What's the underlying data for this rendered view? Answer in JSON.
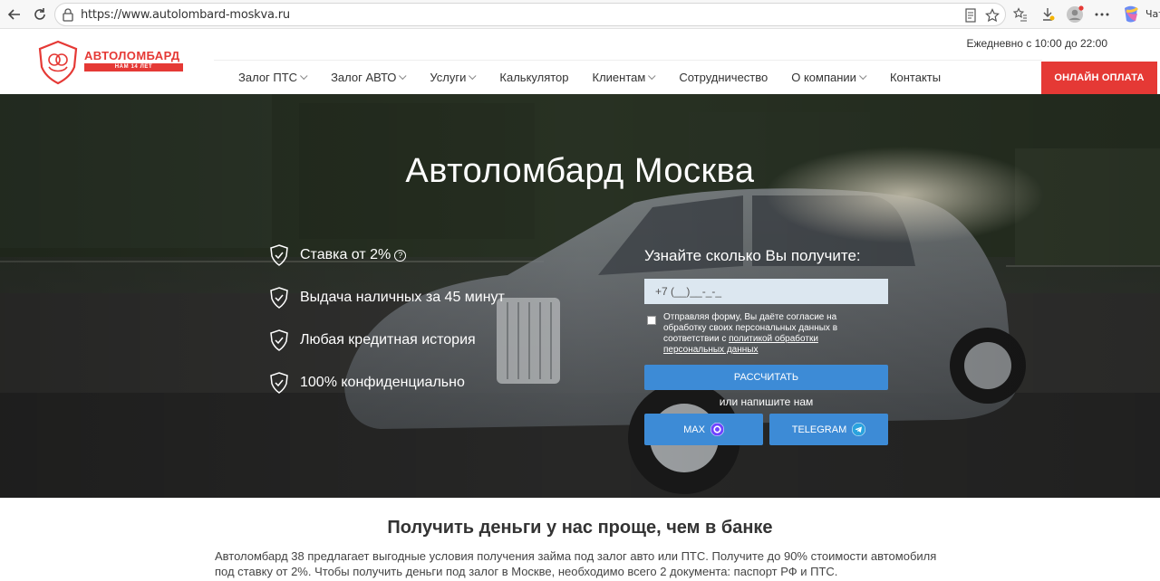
{
  "browser": {
    "url": "https://www.autolombard-moskva.ru",
    "chat_label": "Чат"
  },
  "header": {
    "brand": "АВТОЛОМБАРД",
    "brand_tagline": "НАМ 14 ЛЕТ",
    "schedule": "Ежедневно с 10:00 до 22:00",
    "nav": [
      {
        "label": "Залог ПТС",
        "dropdown": true
      },
      {
        "label": "Залог АВТО",
        "dropdown": true
      },
      {
        "label": "Услуги",
        "dropdown": true
      },
      {
        "label": "Калькулятор",
        "dropdown": false
      },
      {
        "label": "Клиентам",
        "dropdown": true
      },
      {
        "label": "Сотрудничество",
        "dropdown": false
      },
      {
        "label": "О компании",
        "dropdown": true
      },
      {
        "label": "Контакты",
        "dropdown": false
      }
    ],
    "pay_button": "ОНЛАЙН ОПЛАТА"
  },
  "hero": {
    "title": "Автоломбард Москва",
    "features": [
      "Ставка от 2%",
      "Выдача наличных за 45 минут",
      "Любая кредитная история",
      "100% конфиденциально"
    ],
    "form": {
      "title": "Узнайте сколько Вы получите:",
      "phone_placeholder": "+7 (__)__-_-_",
      "consent_text": "Отправляя форму, Вы даёте согласие на обработку своих персональных данных в соответствии с",
      "consent_link": "политикой обработки персональных данных",
      "submit": "РАССЧИТАТЬ",
      "or_write": "или напишите нам",
      "max_button": "MAX",
      "telegram_button": "TELEGRAM"
    }
  },
  "content": {
    "title": "Получить деньги у нас проще, чем в банке",
    "text": "Автоломбард 38 предлагает выгодные условия получения займа под залог авто или ПТС. Получите до 90% стоимости автомобиля под ставку от 2%. Чтобы получить деньги под залог в Москве, необходимо всего 2 документа: паспорт РФ и ПТС."
  },
  "colors": {
    "accent_red": "#e53935",
    "button_blue": "#3d8bd6",
    "input_bg": "#dce7f0"
  }
}
